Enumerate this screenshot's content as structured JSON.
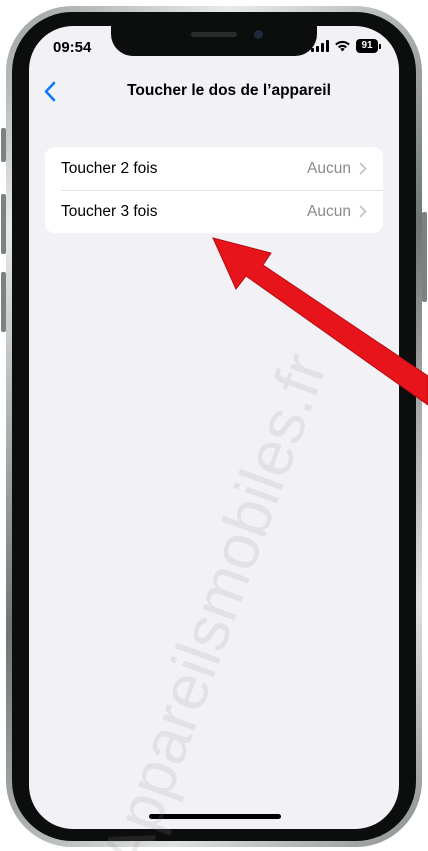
{
  "status_bar": {
    "time": "09:54",
    "battery_level": "91"
  },
  "nav": {
    "back_icon": "chevron-left-icon",
    "title": "Toucher le dos de l’appareil"
  },
  "settings": {
    "rows": [
      {
        "label": "Toucher 2 fois",
        "value": "Aucun"
      },
      {
        "label": "Toucher 3 fois",
        "value": "Aucun"
      }
    ]
  },
  "watermark": "Appareilsmobiles.fr",
  "colors": {
    "accent": "#0a7aff",
    "background": "#f2f1f6",
    "annotation_arrow": "#e8141c"
  }
}
